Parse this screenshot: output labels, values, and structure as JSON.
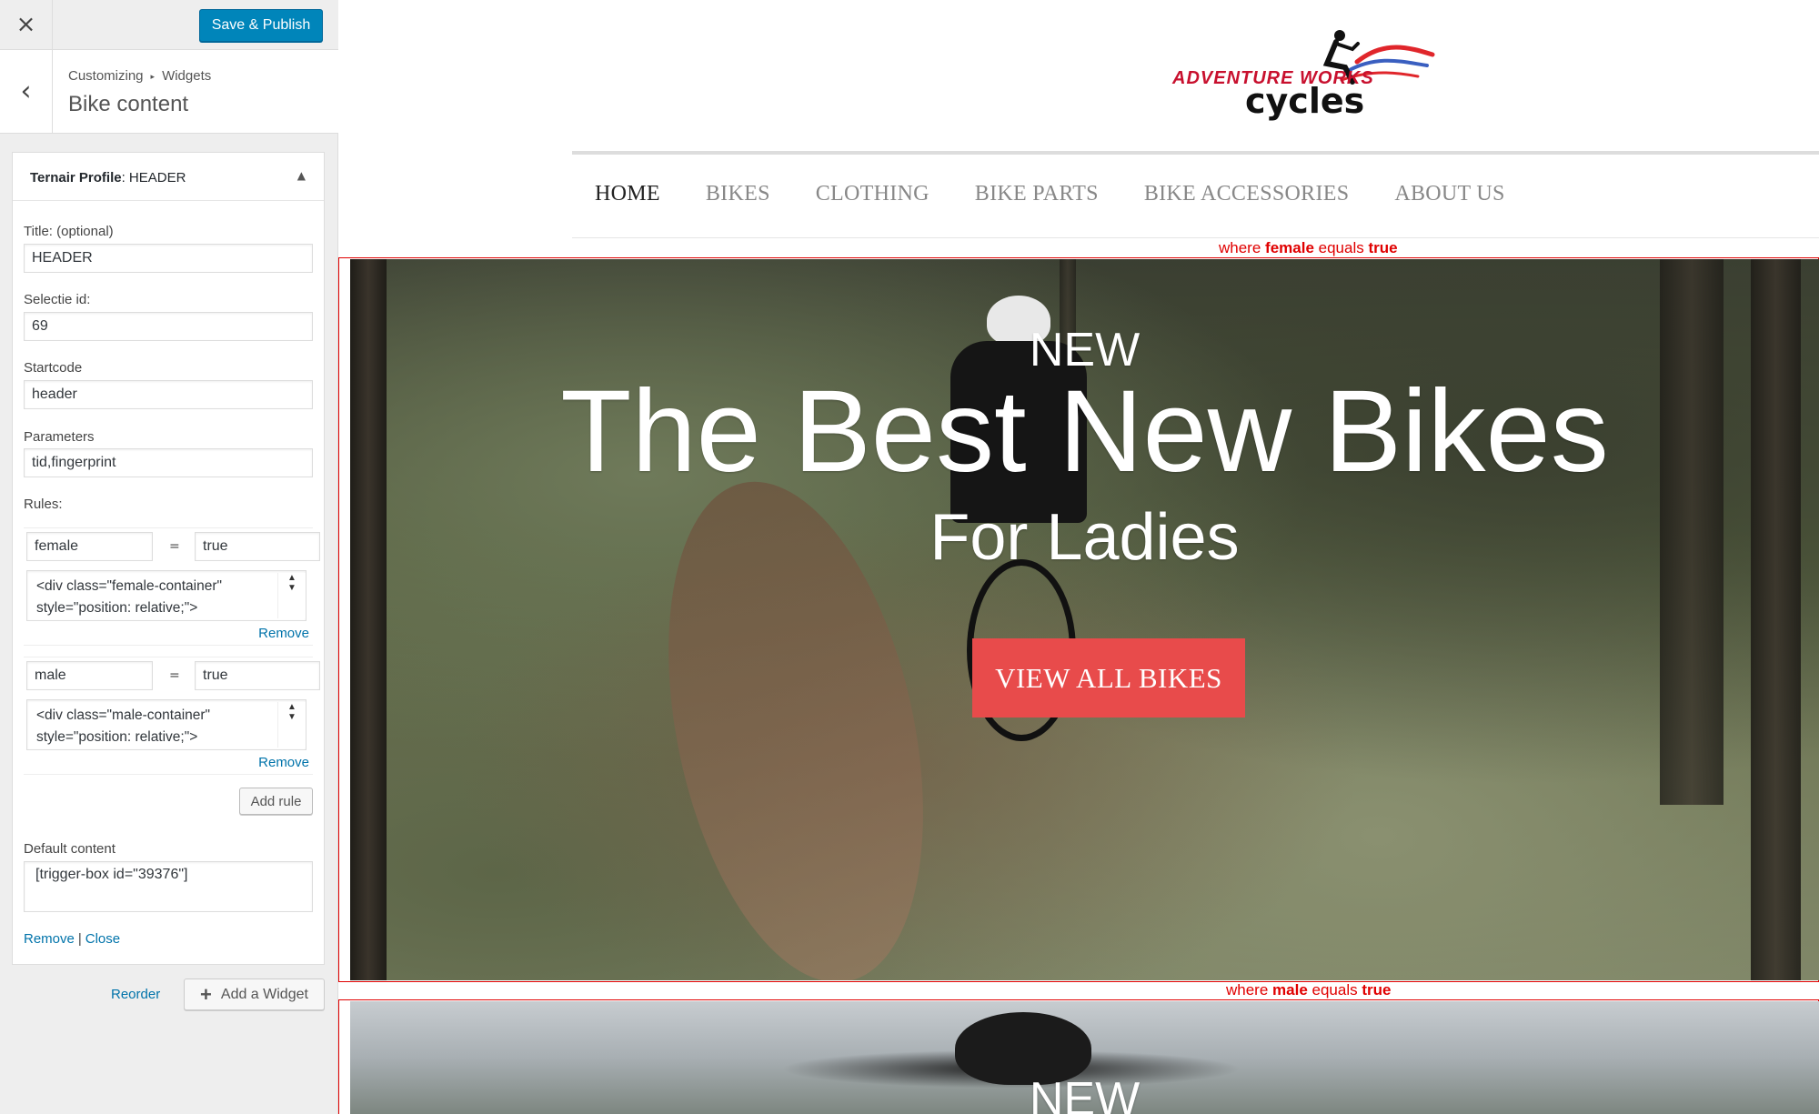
{
  "topbar": {
    "close_icon": "×",
    "save_label": "Save & Publish"
  },
  "section": {
    "back_icon": "‹",
    "breadcrumb_root": "Customizing",
    "breadcrumb_sep": "▸",
    "breadcrumb_leaf": "Widgets",
    "title": "Bike content"
  },
  "widget": {
    "title_prefix": "Ternair Profile",
    "title_suffix": ": HEADER",
    "toggle_icon": "▲",
    "fields": {
      "title_label": "Title: (optional)",
      "title_value": "HEADER",
      "selectie_label": "Selectie id:",
      "selectie_value": "69",
      "startcode_label": "Startcode",
      "startcode_value": "header",
      "parameters_label": "Parameters",
      "parameters_value": "tid,fingerprint",
      "rules_label": "Rules:"
    },
    "rules": [
      {
        "key": "female",
        "op": "=",
        "value": "true",
        "code": "<div class=\"female-container\"\nstyle=\"position: relative;\">",
        "remove": "Remove"
      },
      {
        "key": "male",
        "op": "=",
        "value": "true",
        "code": "<div class=\"male-container\"\nstyle=\"position: relative;\">",
        "remove": "Remove"
      }
    ],
    "add_rule": "Add rule",
    "default_label": "Default content",
    "default_value": "[trigger-box id=\"39376\"]",
    "remove_link": "Remove",
    "separator": "|",
    "close_link": "Close"
  },
  "footer": {
    "reorder": "Reorder",
    "add_widget_icon": "+",
    "add_widget": "Add a Widget"
  },
  "preview": {
    "logo_top": "ADVENTURE WORKS",
    "logo_bottom": "cycles",
    "nav": [
      "HOME",
      "BIKES",
      "CLOTHING",
      "BIKE PARTS",
      "BIKE ACCESSORIES",
      "ABOUT US"
    ],
    "female_label": {
      "pre": "where ",
      "key": "female",
      "mid": " equals ",
      "val": "true"
    },
    "male_label": {
      "pre": "where ",
      "key": "male",
      "mid": " equals ",
      "val": "true"
    },
    "hero_female": {
      "kicker": "NEW",
      "headline": "The Best New Bikes",
      "sub": "For Ladies",
      "cta": "VIEW ALL BIKES"
    },
    "hero_male": {
      "kicker": "NEW"
    }
  },
  "colors": {
    "accent": "#0085ba",
    "link": "#0073aa",
    "cta": "#e84b4b",
    "condition": "#e00000"
  }
}
